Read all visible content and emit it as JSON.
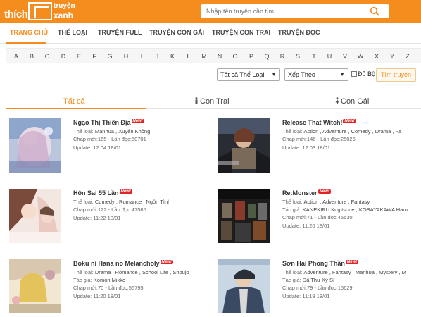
{
  "header": {
    "logo_thich": "thích",
    "logo_truyen": "truyện",
    "logo_xanh": "xanh",
    "search_placeholder": "Nhập tên truyện cần tìm ...",
    "brand_color": "#f58d1e"
  },
  "nav": {
    "items": [
      "TRANG CHỦ",
      "THỂ LOẠI",
      "TRUYỆN FULL",
      "TRUYỆN CON GÁI",
      "TRUYỆN CON TRAI",
      "TRUYỆN ĐỌC"
    ],
    "active": "TRANG CHỦ"
  },
  "alphabet": [
    "A",
    "B",
    "C",
    "D",
    "E",
    "F",
    "G",
    "H",
    "I",
    "J",
    "K",
    "L",
    "M",
    "N",
    "O",
    "P",
    "Q",
    "R",
    "S",
    "T",
    "U",
    "V",
    "W",
    "X",
    "Y",
    "Z"
  ],
  "filters": {
    "genre_select": "Tất cả Thể Loại",
    "sort_select": "Xếp Theo",
    "full_label": "Đủ Bộ",
    "full_checked": false,
    "find_button": "Tìm truyện"
  },
  "categories": {
    "all": "Tất cả",
    "boys": "Con Trai",
    "girls": "Con Gái",
    "active": "Tất cả"
  },
  "labels": {
    "genre": "Thể loại:",
    "author": "Tác giả:",
    "chapter": "Chap mới:",
    "views": "Lần đọc:",
    "update": "Update:",
    "new_badge": "New!"
  },
  "manga": [
    {
      "title": "Ngạo Thị Thiên Địa",
      "genres": "Manhua , Xuyên Không",
      "author": "",
      "chapter": "165",
      "views": "50701",
      "update": "12:04 18/01",
      "new": true
    },
    {
      "title": "Release That Witch!",
      "genres": "Action , Adventure , Comedy , Drama , Fa",
      "author": "",
      "chapter": "146",
      "views": "25026",
      "update": "12:03 18/01",
      "new": true
    },
    {
      "title": "Hôn Sai 55 Lần",
      "genres": "Comedy , Romance , Ngôn Tình",
      "author": "",
      "chapter": "122",
      "views": "47585",
      "update": "11:22 18/01",
      "new": true
    },
    {
      "title": "Re:Monster",
      "genres": "Action , Adventure , Fantasy",
      "author": "KANEKIRU Kogitsune , KOBAYAKAWA Haru",
      "chapter": "71",
      "views": "45530",
      "update": "11:20 18/01",
      "new": true
    },
    {
      "title": "Boku ni Hana no Melancholy",
      "genres": "Drama , Romance , School Life , Shoujo",
      "author": "Komori Mikko",
      "chapter": "70",
      "views": "55795",
      "update": "11:20 18/01",
      "new": true
    },
    {
      "title": "Sơn Hải Phong Thần",
      "genres": "Adventure , Fantasy , Manhua , Mystery , M",
      "author": "Dã Thư Kỳ Sĩ",
      "chapter": "79",
      "views": "15629",
      "update": "11:19 18/01",
      "new": true
    }
  ]
}
